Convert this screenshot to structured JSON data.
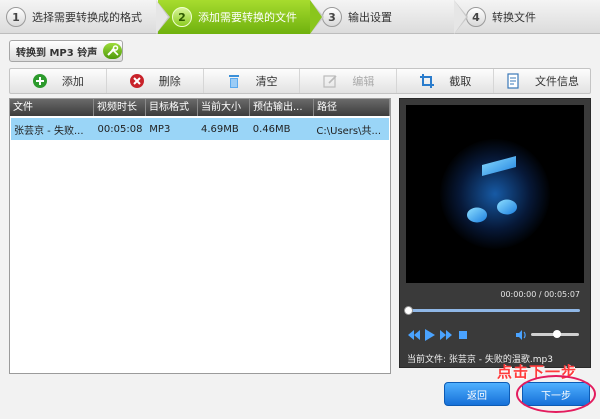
{
  "steps": [
    {
      "num": "1",
      "label": "选择需要转换成的格式",
      "active": false
    },
    {
      "num": "2",
      "label": "添加需要转换的文件",
      "active": true
    },
    {
      "num": "3",
      "label": "输出设置",
      "active": false
    },
    {
      "num": "4",
      "label": "转换文件",
      "active": false
    }
  ],
  "mode_button": {
    "label": "转换到 MP3 铃声",
    "icon": "tools-icon"
  },
  "toolbar": {
    "add": "添加",
    "delete": "删除",
    "clear": "清空",
    "edit": "编辑",
    "crop": "截取",
    "info": "文件信息"
  },
  "file_table": {
    "columns": [
      "文件",
      "视频时长",
      "目标格式",
      "当前大小",
      "预估输出...",
      "路径"
    ],
    "rows": [
      [
        "张芸京 - 失败...",
        "00:05:08",
        "MP3",
        "4.69MB",
        "0.46MB",
        "C:\\Users\\共..."
      ]
    ]
  },
  "preview": {
    "time": "00:00:00 / 00:05:07",
    "seek_fraction": 0.0,
    "volume_fraction": 0.55,
    "now_playing": "当前文件: 张芸京 - 失败的温歌.mp3",
    "colors": {
      "accent": "#1aa3ff",
      "background": "#000000"
    }
  },
  "hint": "点击下一步",
  "buttons": {
    "back": "返回",
    "next": "下一步"
  },
  "colors": {
    "active_step": "#7ec11a",
    "selected_row": "#9ad5f7",
    "button": "#2a8cef",
    "highlight_ring": "#e31c5e"
  }
}
